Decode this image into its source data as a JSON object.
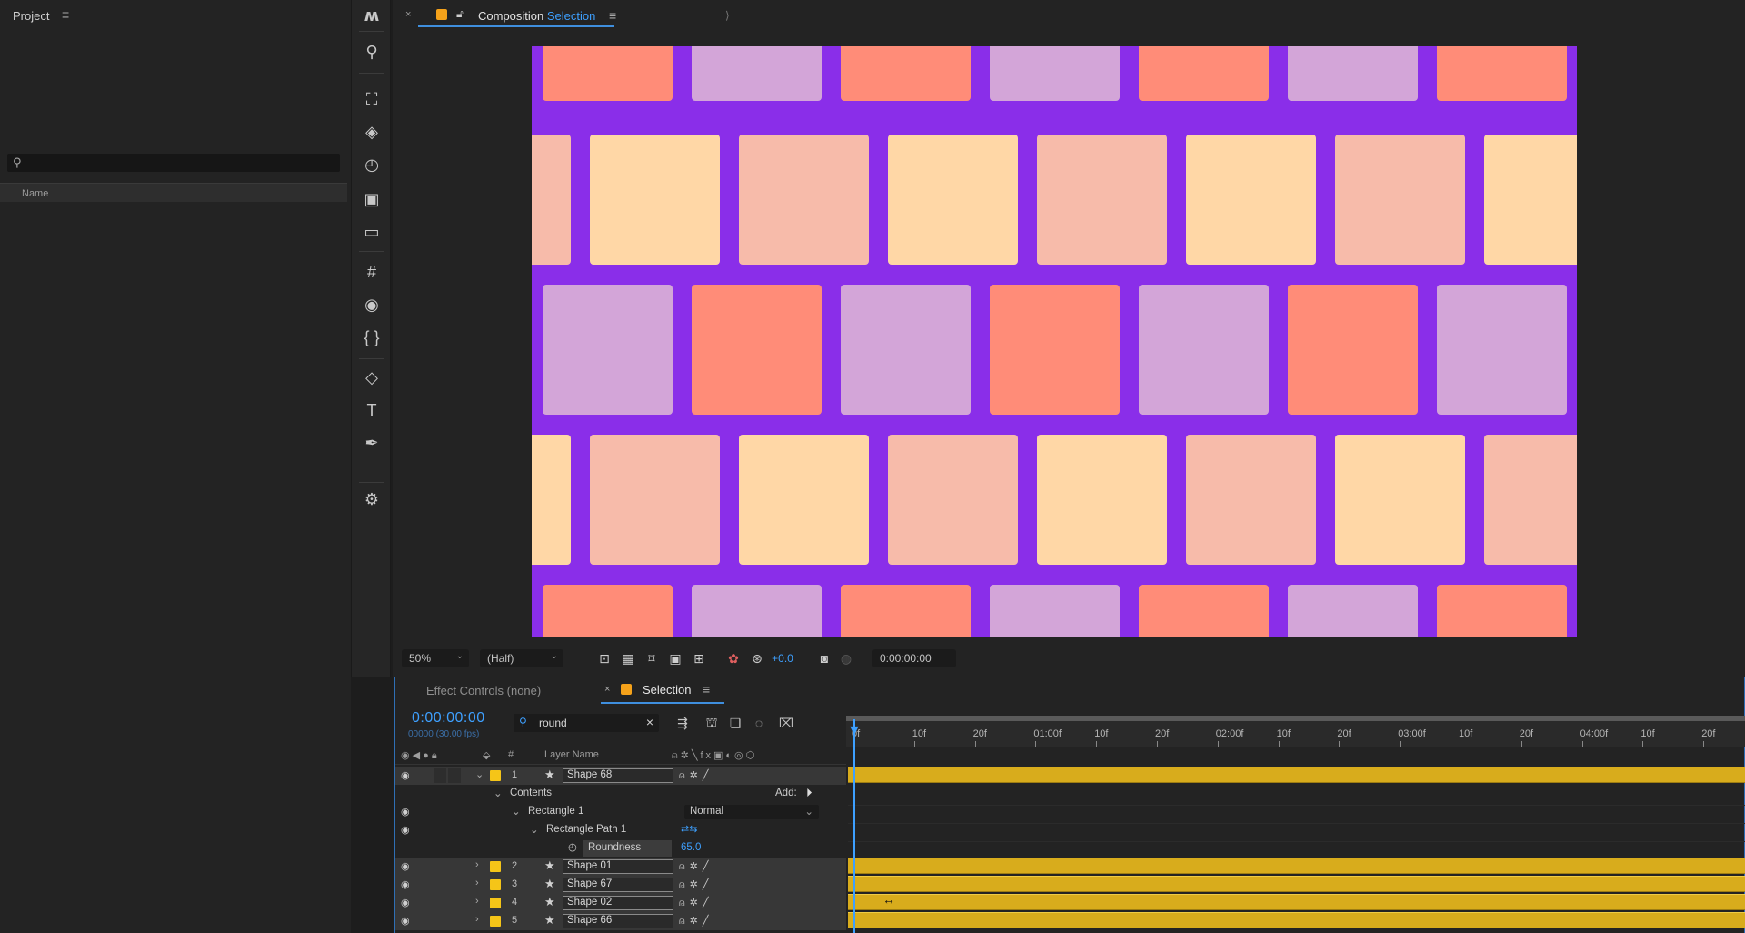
{
  "project": {
    "title": "Project",
    "column_name": "Name"
  },
  "tools": [
    "adobe-logo-icon",
    "search-icon",
    "selection-icon",
    "layers-icon",
    "stopwatch-icon",
    "composition-icon",
    "folder-icon",
    "grid-icon",
    "eye-icon",
    "braces-icon",
    "shapes-icon",
    "text-icon",
    "pen-icon",
    "settings-icon"
  ],
  "composition": {
    "tab_prefix": "Composition",
    "tab_name": "Selection",
    "canvas_bg": "#8a2ee9",
    "tile_colors": {
      "coral": "#ff8c78",
      "lilac": "#d3a5d8",
      "peach": "#ffd7a6",
      "salmon": "#f7bbaa"
    }
  },
  "viewer_bar": {
    "zoom": "50%",
    "resolution": "(Half)",
    "exposure": "+0.0",
    "time": "0:00:00:00"
  },
  "timeline": {
    "tab_effect_controls": "Effect Controls (none)",
    "tab_comp": "Selection",
    "timecode": "0:00:00:00",
    "fps": "00000 (30.00 fps)",
    "search_value": "round",
    "col_num": "#",
    "col_layer_name": "Layer Name",
    "ruler": [
      "0f",
      "10f",
      "20f",
      "01:00f",
      "10f",
      "20f",
      "02:00f",
      "10f",
      "20f",
      "03:00f",
      "10f",
      "20f",
      "04:00f",
      "10f",
      "20f"
    ],
    "layers": [
      {
        "index": "1",
        "name": "Shape 68"
      },
      {
        "index": "2",
        "name": "Shape 01"
      },
      {
        "index": "3",
        "name": "Shape 67"
      },
      {
        "index": "4",
        "name": "Shape 02"
      },
      {
        "index": "5",
        "name": "Shape 66"
      }
    ],
    "contents_label": "Contents",
    "add_label": "Add:",
    "rectangle_label": "Rectangle 1",
    "blend_mode": "Normal",
    "path_label": "Rectangle Path 1",
    "roundness_label": "Roundness",
    "roundness_value": "65.0"
  }
}
